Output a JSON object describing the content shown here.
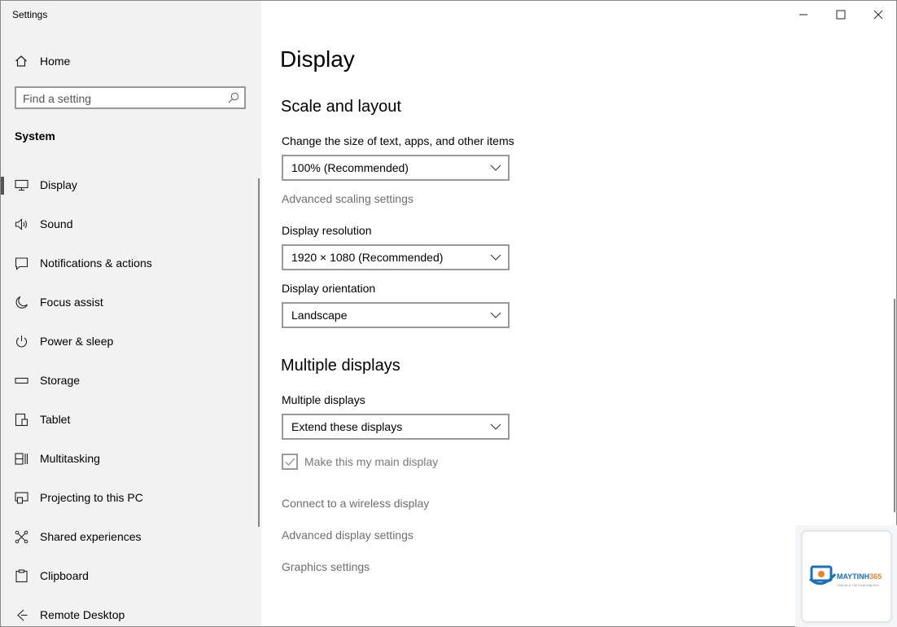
{
  "window": {
    "title": "Settings",
    "minimize_icon": "minimize-icon",
    "maximize_icon": "maximize-icon",
    "close_icon": "close-icon"
  },
  "sidebar": {
    "home_label": "Home",
    "search_placeholder": "Find a setting",
    "section": "System",
    "items": [
      {
        "label": "Display",
        "icon": "monitor-icon",
        "selected": true
      },
      {
        "label": "Sound",
        "icon": "speaker-icon"
      },
      {
        "label": "Notifications & actions",
        "icon": "notification-icon"
      },
      {
        "label": "Focus assist",
        "icon": "moon-icon"
      },
      {
        "label": "Power & sleep",
        "icon": "power-icon"
      },
      {
        "label": "Storage",
        "icon": "storage-icon"
      },
      {
        "label": "Tablet",
        "icon": "tablet-icon"
      },
      {
        "label": "Multitasking",
        "icon": "multitasking-icon"
      },
      {
        "label": "Projecting to this PC",
        "icon": "projecting-icon"
      },
      {
        "label": "Shared experiences",
        "icon": "shared-icon"
      },
      {
        "label": "Clipboard",
        "icon": "clipboard-icon"
      },
      {
        "label": "Remote Desktop",
        "icon": "remote-desktop-icon"
      }
    ]
  },
  "main": {
    "page_title": "Display",
    "scale_section": {
      "heading": "Scale and layout",
      "size_label": "Change the size of text, apps, and other items",
      "size_value": "100% (Recommended)",
      "advanced_scaling_link": "Advanced scaling settings",
      "resolution_label": "Display resolution",
      "resolution_value": "1920 × 1080 (Recommended)",
      "orientation_label": "Display orientation",
      "orientation_value": "Landscape"
    },
    "multiple_section": {
      "heading": "Multiple displays",
      "label": "Multiple displays",
      "value": "Extend these displays",
      "main_display_checkbox": "Make this my main display",
      "main_display_checked": true,
      "wireless_link": "Connect to a wireless display",
      "advanced_display_link": "Advanced display settings",
      "graphics_link": "Graphics settings"
    }
  },
  "watermark": {
    "brand_prefix": "MAYTINH",
    "brand_suffix": "365",
    "tagline": "Chia sẻ & Thủ thuật Máy tính"
  },
  "colors": {
    "sidebar_bg": "#f2f2f2",
    "link_gray": "#6e6e6e",
    "brand_blue": "#1c6fb8",
    "brand_orange": "#e8822a"
  }
}
